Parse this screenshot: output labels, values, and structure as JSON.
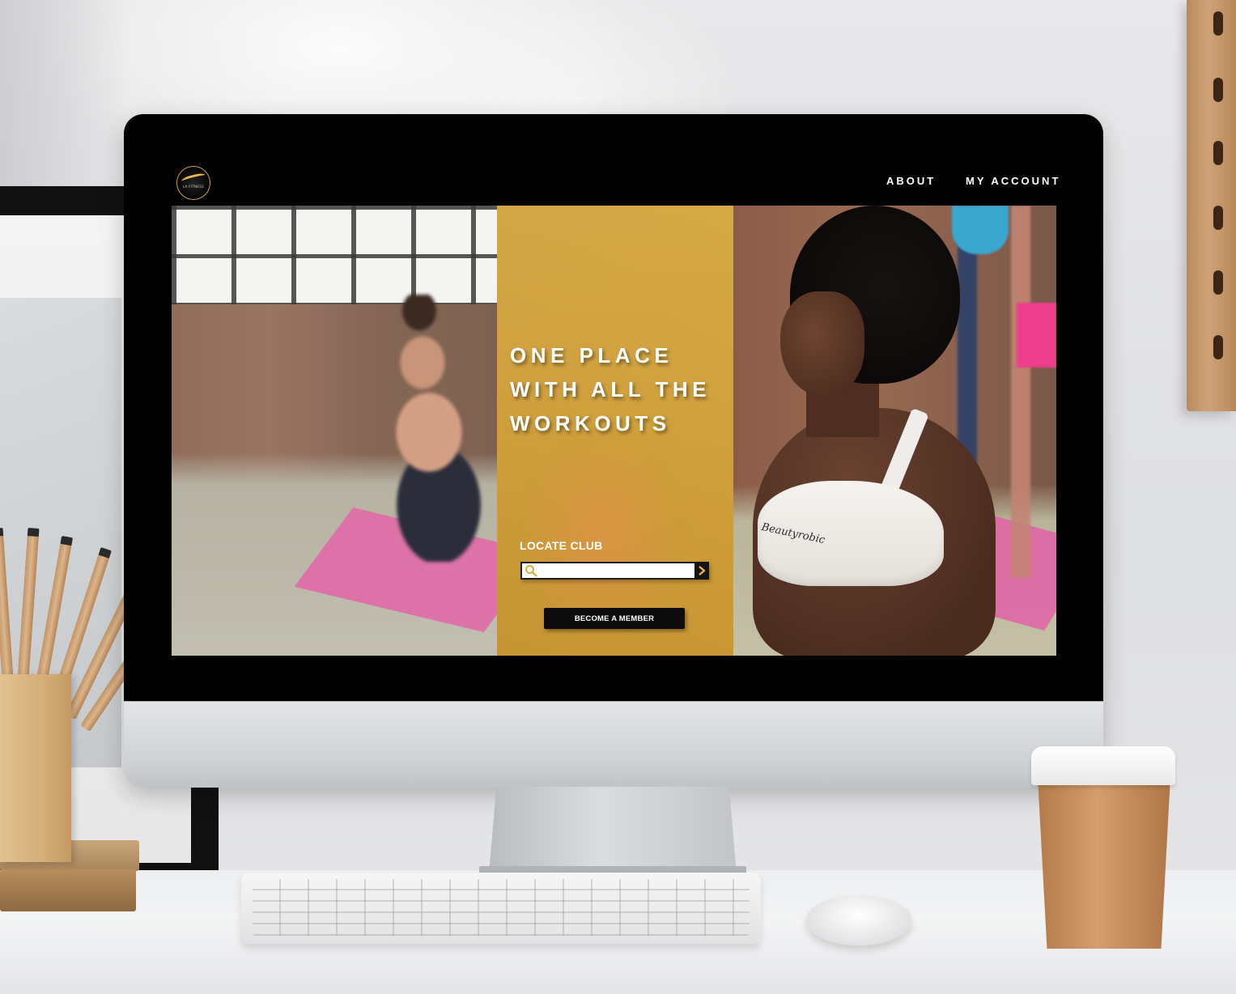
{
  "site": {
    "logo_text": "LA FITNESS",
    "nav": {
      "about": "ABOUT",
      "account": "MY ACCOUNT"
    }
  },
  "hero": {
    "headline": [
      "ONE PLACE",
      "WITH ALL THE",
      "WORKOUTS"
    ],
    "locate_label": "LOCATE CLUB",
    "search": {
      "value": "",
      "placeholder": ""
    },
    "search_button_icon": "chevron-right-icon",
    "member_button": "BECOME A MEMBER",
    "apparel_text": "Beautyrobic"
  },
  "colors": {
    "accent": "#d4a24c",
    "accent_dark": "#c9a24b",
    "nav_text": "#ffffff",
    "button_bg": "#0c0c0c"
  }
}
